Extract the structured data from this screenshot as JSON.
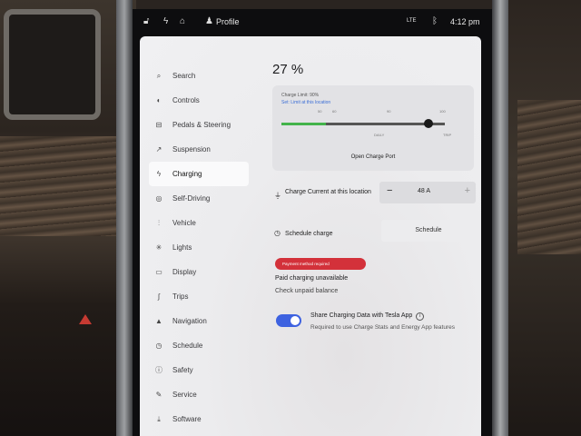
{
  "statusbar": {
    "profile_label": "Profile",
    "lte": "LTE",
    "time": "4:12 pm"
  },
  "sidebar": {
    "items": [
      {
        "label": "Search",
        "icon": "search-icon",
        "glyph": "⌕"
      },
      {
        "label": "Controls",
        "icon": "toggle-icon",
        "glyph": "◐"
      },
      {
        "label": "Pedals & Steering",
        "icon": "car-icon",
        "glyph": "⊟"
      },
      {
        "label": "Suspension",
        "icon": "suspension-icon",
        "glyph": "↗"
      },
      {
        "label": "Charging",
        "icon": "bolt-icon",
        "glyph": "ϟ"
      },
      {
        "label": "Self-Driving",
        "icon": "steering-wheel-icon",
        "glyph": "◎"
      },
      {
        "label": "Vehicle",
        "icon": "sliders-icon",
        "glyph": "⫶"
      },
      {
        "label": "Lights",
        "icon": "sun-icon",
        "glyph": "✳"
      },
      {
        "label": "Display",
        "icon": "display-icon",
        "glyph": "▭"
      },
      {
        "label": "Trips",
        "icon": "trips-icon",
        "glyph": "∫"
      },
      {
        "label": "Navigation",
        "icon": "navigation-icon",
        "glyph": "▲"
      },
      {
        "label": "Schedule",
        "icon": "clock-icon",
        "glyph": "◷"
      },
      {
        "label": "Safety",
        "icon": "safety-icon",
        "glyph": "ⓘ"
      },
      {
        "label": "Service",
        "icon": "wrench-icon",
        "glyph": "✎"
      },
      {
        "label": "Software",
        "icon": "download-icon",
        "glyph": "⤓"
      }
    ],
    "active_index": 4
  },
  "main": {
    "battery_percent": "27 %",
    "charge_limit": {
      "label": "Charge Limit: 90%",
      "sublabel": "Set: Limit at this location",
      "tick_top": [
        "50",
        "60",
        "90",
        "100"
      ],
      "tick_bottom": [
        "DAILY",
        "TRIP"
      ],
      "value": 90,
      "current_level": 27,
      "open_port_label": "Open Charge Port"
    },
    "charge_current": {
      "label": "Charge Current at this location",
      "minus": "−",
      "value": "48 A",
      "plus": "+"
    },
    "schedule": {
      "label": "Schedule charge",
      "button": "Schedule"
    },
    "payment": {
      "badge": "Payment method required",
      "status": "Paid charging unavailable",
      "action": "Check unpaid balance"
    },
    "share": {
      "label": "Share Charging Data with Tesla App",
      "sublabel": "Required to use Charge Stats and Energy App features",
      "enabled": true
    }
  },
  "colors": {
    "accent_blue": "#3e62e0",
    "warning_red": "#d3313a",
    "charge_green": "#43b34a"
  }
}
